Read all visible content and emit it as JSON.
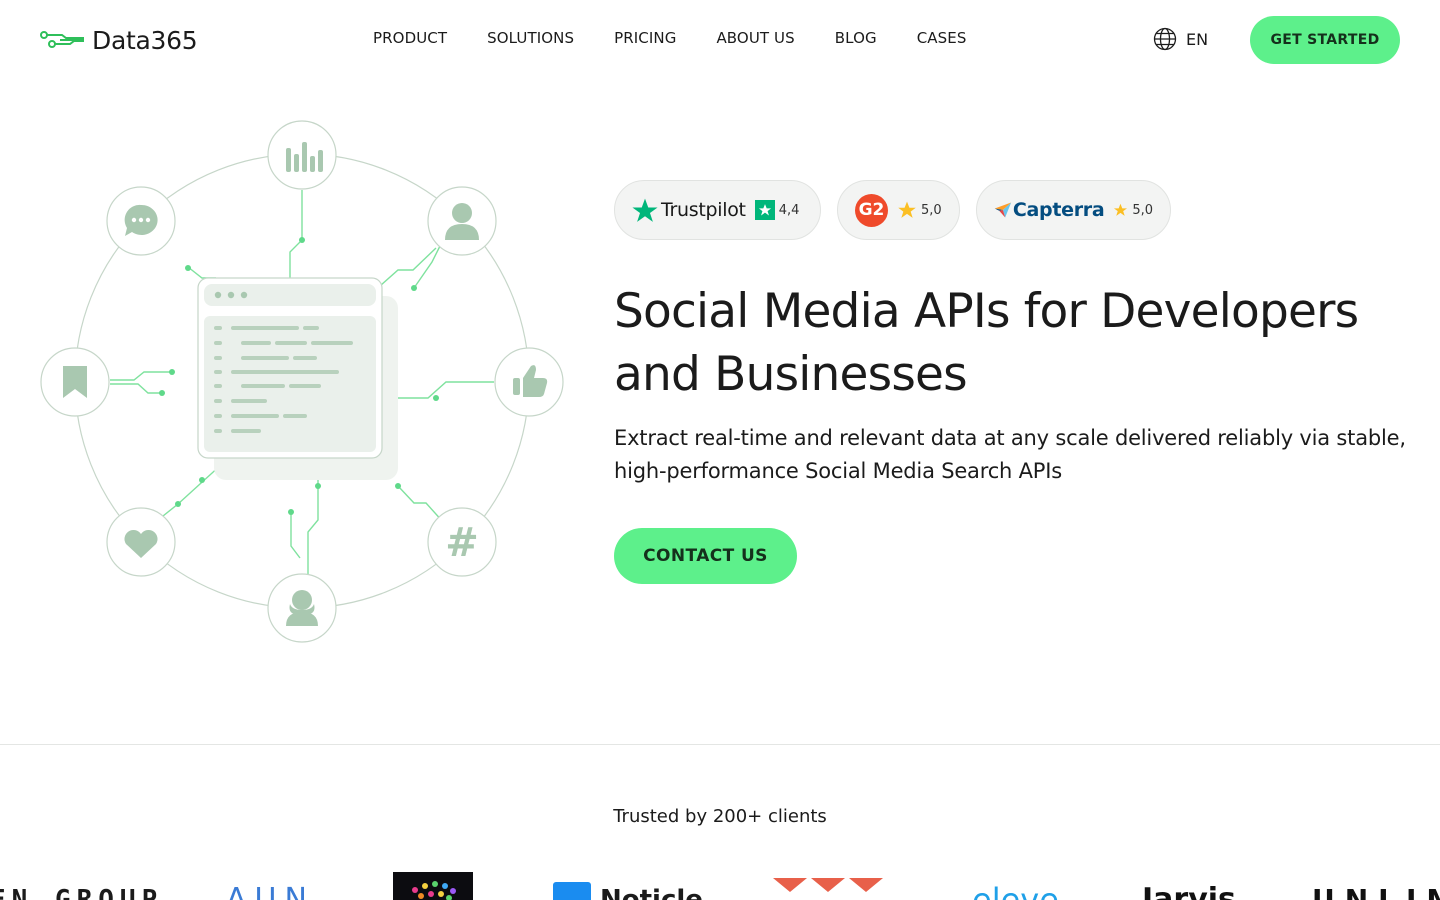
{
  "brand": {
    "name": "Data365"
  },
  "nav": {
    "items": [
      {
        "label": "PRODUCT"
      },
      {
        "label": "SOLUTIONS"
      },
      {
        "label": "PRICING"
      },
      {
        "label": "ABOUT US"
      },
      {
        "label": "BLOG"
      },
      {
        "label": "CASES"
      }
    ]
  },
  "language": {
    "label": "EN"
  },
  "header": {
    "cta_label": "GET STARTED"
  },
  "ratings": [
    {
      "name": "Trustpilot",
      "score": "4,4"
    },
    {
      "name": "G2",
      "score": "5,0"
    },
    {
      "name": "Capterra",
      "score": "5,0"
    }
  ],
  "hero": {
    "title": "Social Media APIs for Developers and Businesses",
    "subtitle": "Extract real-time and relevant data at any scale delivered reliably via stable, high-performance Social Media Search APIs",
    "cta_label": "CONTACT US"
  },
  "clients": {
    "heading": "Trusted by 200+ clients",
    "logos": [
      "EN GROUP",
      "AUN",
      "Noticle",
      "eleve",
      "Jarvis",
      "UNLIM"
    ]
  },
  "colors": {
    "accent": "#5df08b",
    "illustration_icon": "#a9c8b0",
    "trustpilot": "#00b67a",
    "g2": "#ef4a2b",
    "capterra": "#044d80",
    "star": "#fbbf24"
  }
}
